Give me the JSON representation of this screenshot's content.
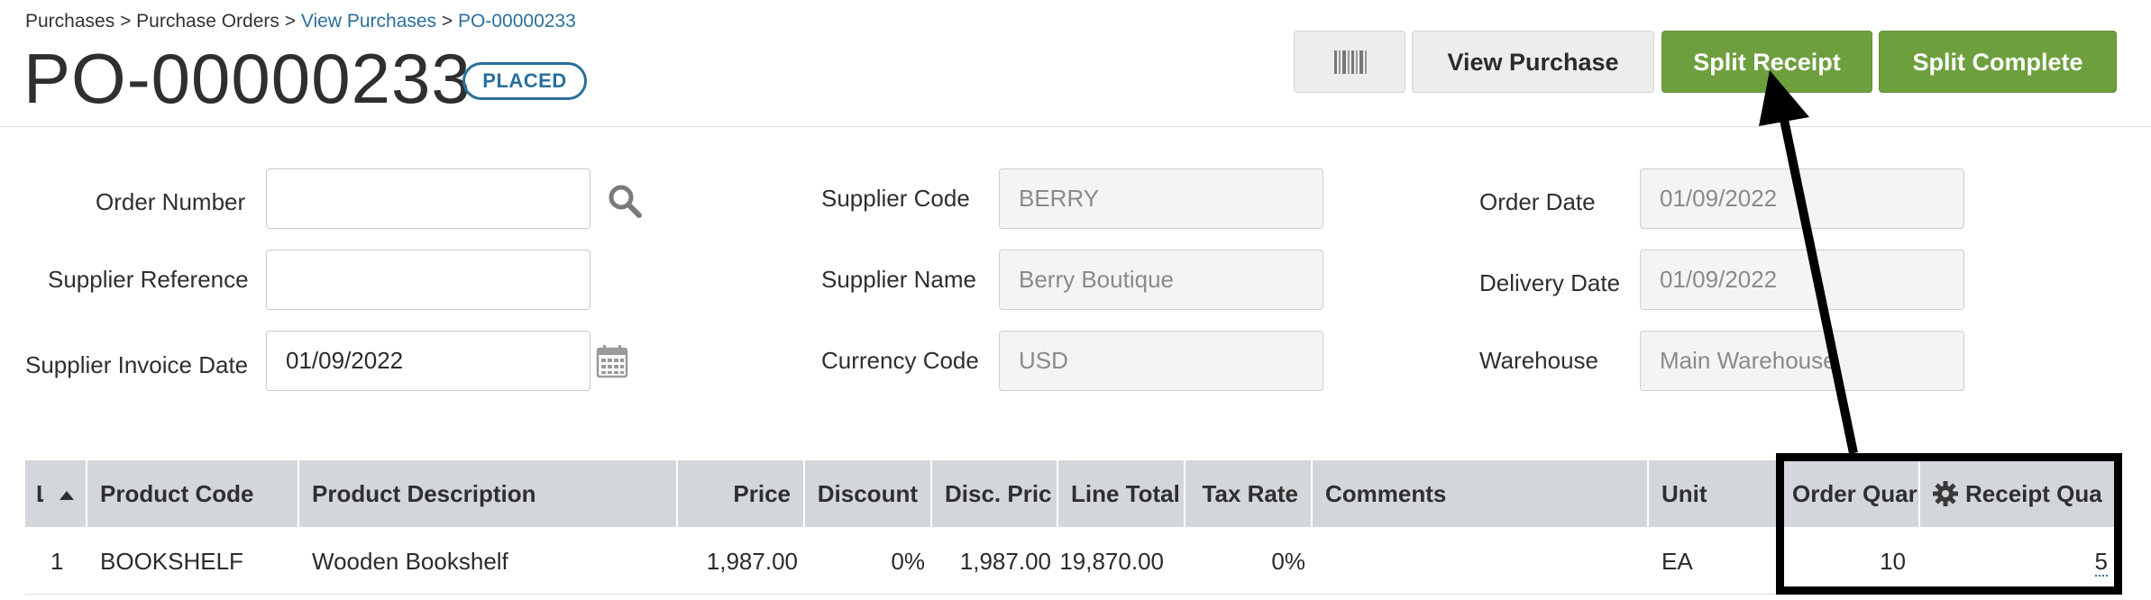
{
  "breadcrumb": {
    "items": [
      "Purchases",
      "Purchase Orders",
      "View Purchases",
      "PO-00000233"
    ],
    "separator": ">"
  },
  "header": {
    "title": "PO-00000233",
    "status": "PLACED"
  },
  "toolbar": {
    "barcode_icon": "barcode-icon",
    "view_purchase_label": "View Purchase",
    "split_receipt_label": "Split Receipt",
    "split_complete_label": "Split Complete"
  },
  "form": {
    "order_number": {
      "label": "Order Number",
      "value": ""
    },
    "supplier_reference": {
      "label": "Supplier Reference",
      "value": ""
    },
    "supplier_invoice_date": {
      "label": "Supplier Invoice Date",
      "value": "01/09/2022"
    },
    "supplier_code": {
      "label": "Supplier Code",
      "value": "BERRY"
    },
    "supplier_name": {
      "label": "Supplier Name",
      "value": "Berry Boutique"
    },
    "currency_code": {
      "label": "Currency Code",
      "value": "USD"
    },
    "order_date": {
      "label": "Order Date",
      "value": "01/09/2022"
    },
    "delivery_date": {
      "label": "Delivery Date",
      "value": "01/09/2022"
    },
    "warehouse": {
      "label": "Warehouse",
      "value": "Main Warehouse"
    }
  },
  "grid": {
    "columns": [
      "L",
      "Product Code",
      "Product Description",
      "Price",
      "Discount",
      "Disc. Pric",
      "Line Total",
      "Tax Rate",
      "Comments",
      "Unit",
      "Order Quar",
      "Receipt Qua"
    ],
    "rows": [
      {
        "line": "1",
        "product_code": "BOOKSHELF",
        "product_description": "Wooden Bookshelf",
        "price": "1,987.00",
        "discount": "0%",
        "disc_price": "1,987.00",
        "line_total": "19,870.00",
        "tax_rate": "0%",
        "comments": "",
        "unit": "EA",
        "order_qty": "10",
        "receipt_qty": "5"
      }
    ]
  },
  "colors": {
    "accent_link": "#2a6f9b",
    "button_green": "#6e9f3e",
    "grid_header": "#d3d7dc",
    "annotation": "#000000"
  }
}
